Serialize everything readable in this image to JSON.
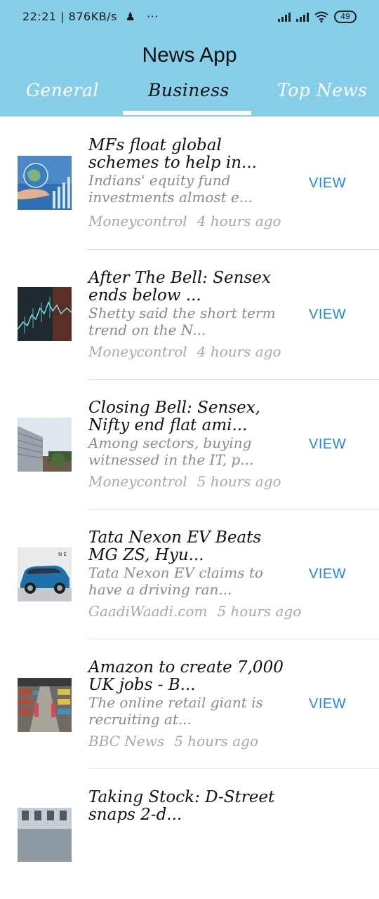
{
  "status_bar": {
    "time_net": "22:21 | 876KB/s",
    "dots": "···",
    "battery": "49"
  },
  "app_title": "News App",
  "tabs": [
    {
      "label": "General"
    },
    {
      "label": "Business",
      "active": true
    },
    {
      "label": "Top News"
    }
  ],
  "view_label": "VIEW",
  "articles": [
    {
      "title": "MFs float global schemes to help in...",
      "description": "Indians' equity fund investments almost e...",
      "source": "Moneycontrol",
      "time": "4 hours ago",
      "thumb_icon": "globe-hand-chart-thumbnail"
    },
    {
      "title": "After The Bell: Sensex ends below ...",
      "description": "Shetty said the short term trend on the N...",
      "source": "Moneycontrol",
      "time": "4 hours ago",
      "thumb_icon": "stock-chart-thumbnail"
    },
    {
      "title": "Closing Bell: Sensex, Nifty end flat ami...",
      "description": "Among sectors, buying witnessed in the IT, p...",
      "source": "Moneycontrol",
      "time": "5 hours ago",
      "thumb_icon": "stock-exchange-building-thumbnail"
    },
    {
      "title": "Tata Nexon EV Beats MG ZS, Hyu...",
      "description": "Tata Nexon EV claims to have a driving ran...",
      "source": "GaadiWaadi.com",
      "time": "5 hours ago",
      "thumb_icon": "blue-suv-thumbnail"
    },
    {
      "title": "Amazon to create 7,000 UK jobs - B...",
      "description": "The online retail giant is recruiting at...",
      "source": "BBC News",
      "time": "5 hours ago",
      "thumb_icon": "warehouse-thumbnail"
    },
    {
      "title": "Taking Stock: D-Street snaps 2-d...",
      "description": "",
      "source": "",
      "time": "",
      "thumb_icon": "street-scene-thumbnail"
    }
  ]
}
